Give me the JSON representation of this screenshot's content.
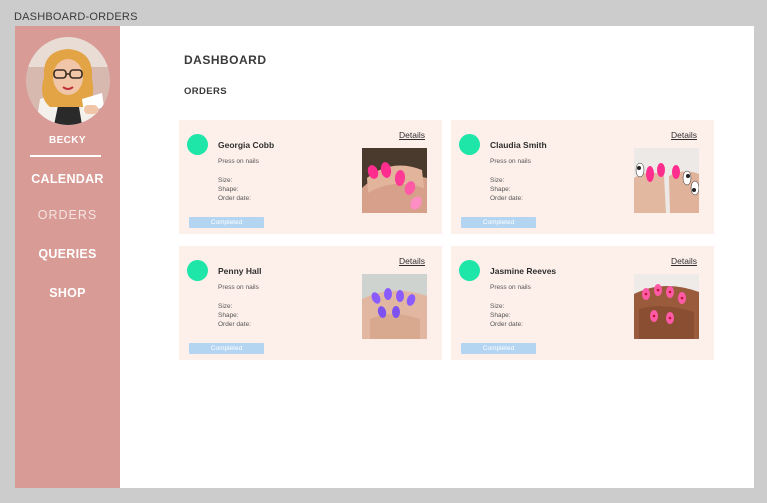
{
  "frame": {
    "label": "DASHBOARD-ORDERS"
  },
  "sidebar": {
    "user_name": "BECKY",
    "nav": [
      {
        "label": "CALENDAR",
        "active": false
      },
      {
        "label": "ORDERS",
        "active": true
      },
      {
        "label": "QUERIES",
        "active": false
      },
      {
        "label": "SHOP",
        "active": false
      }
    ]
  },
  "main": {
    "title": "DASHBOARD",
    "section": "ORDERS",
    "orders": [
      {
        "customer": "Georgia Cobb",
        "details_label": "Details",
        "product": "Press on nails",
        "size_label": "Size:",
        "shape_label": "Shape:",
        "date_label": "Order date:",
        "status": "Completed",
        "photo": "nails-hot-pink-photo"
      },
      {
        "customer": "Claudia Smith",
        "details_label": "Details",
        "product": "Press on nails",
        "size_label": "Size:",
        "shape_label": "Shape:",
        "date_label": "Order date:",
        "status": "Completed",
        "photo": "nails-pink-cow-print-photo"
      },
      {
        "customer": "Penny Hall",
        "details_label": "Details",
        "product": "Press on nails",
        "size_label": "Size:",
        "shape_label": "Shape:",
        "date_label": "Order date:",
        "status": "Completed",
        "photo": "nails-purple-photo"
      },
      {
        "customer": "Jasmine Reeves",
        "details_label": "Details",
        "product": "Press on nails",
        "size_label": "Size:",
        "shape_label": "Shape:",
        "date_label": "Order date:",
        "status": "Completed",
        "photo": "nails-pink-hearts-photo"
      }
    ]
  },
  "colors": {
    "page_background": "#cccccc",
    "sidebar": "#d99b96",
    "card": "#fdf0eb",
    "status_dot": "#1ee6a8",
    "badge": "#b3d5f2"
  }
}
